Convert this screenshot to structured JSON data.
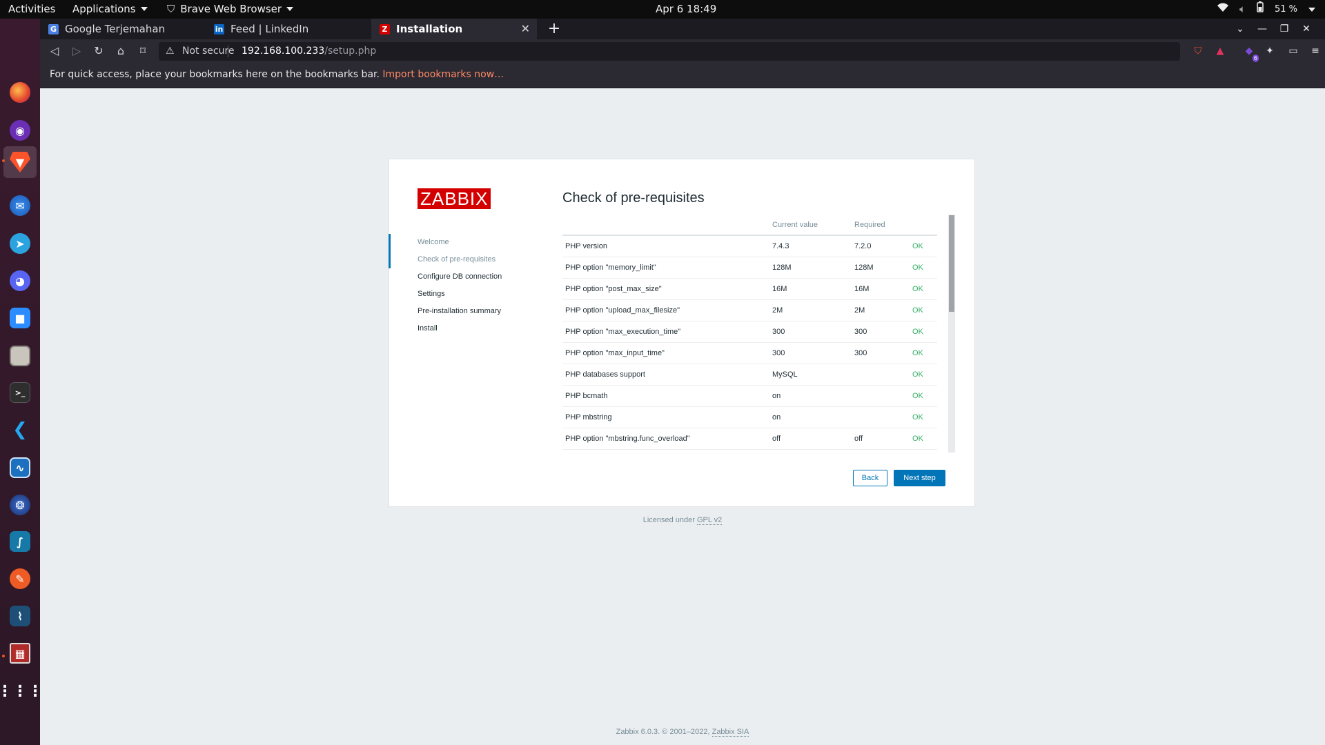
{
  "topbar": {
    "activities": "Activities",
    "applications": "Applications",
    "browser_menu": "Brave Web Browser",
    "clock": "Apr 6  18:49",
    "battery": "51 %"
  },
  "browser": {
    "tabs": [
      {
        "label": "Google Terjemahan",
        "favicon": "google-translate-icon"
      },
      {
        "label": "Feed | LinkedIn",
        "favicon": "linkedin-icon"
      },
      {
        "label": "Installation",
        "favicon": "zabbix-icon"
      }
    ],
    "url": {
      "security": "Not secure",
      "host": "192.168.100.233",
      "path": "/setup.php"
    },
    "extension_badge": "6",
    "bookmarks_bar": {
      "message": "For quick access, place your bookmarks here on the bookmarks bar.",
      "import_link": "Import bookmarks now…"
    }
  },
  "setup": {
    "logo": "ZABBIX",
    "title": "Check of pre-requisites",
    "steps": [
      {
        "label": "Welcome",
        "state": "done"
      },
      {
        "label": "Check of pre-requisites",
        "state": "current"
      },
      {
        "label": "Configure DB connection",
        "state": "todo"
      },
      {
        "label": "Settings",
        "state": "todo"
      },
      {
        "label": "Pre-installation summary",
        "state": "todo"
      },
      {
        "label": "Install",
        "state": "todo"
      }
    ],
    "table": {
      "headers": [
        "",
        "Current value",
        "Required",
        ""
      ],
      "rows": [
        [
          "PHP version",
          "7.4.3",
          "7.2.0",
          "OK"
        ],
        [
          "PHP option \"memory_limit\"",
          "128M",
          "128M",
          "OK"
        ],
        [
          "PHP option \"post_max_size\"",
          "16M",
          "16M",
          "OK"
        ],
        [
          "PHP option \"upload_max_filesize\"",
          "2M",
          "2M",
          "OK"
        ],
        [
          "PHP option \"max_execution_time\"",
          "300",
          "300",
          "OK"
        ],
        [
          "PHP option \"max_input_time\"",
          "300",
          "300",
          "OK"
        ],
        [
          "PHP databases support",
          "MySQL",
          "",
          "OK"
        ],
        [
          "PHP bcmath",
          "on",
          "",
          "OK"
        ],
        [
          "PHP mbstring",
          "on",
          "",
          "OK"
        ],
        [
          "PHP option \"mbstring.func_overload\"",
          "off",
          "off",
          "OK"
        ]
      ]
    },
    "buttons": {
      "back": "Back",
      "next": "Next step"
    },
    "license_text": "Licensed under",
    "license_link": "GPL v2",
    "footer_text": "Zabbix 6.0.3. © 2001–2022,",
    "footer_link": "Zabbix SIA"
  },
  "colors": {
    "accent": "#0275b8",
    "ok": "#34af67",
    "logo": "#d40000"
  }
}
